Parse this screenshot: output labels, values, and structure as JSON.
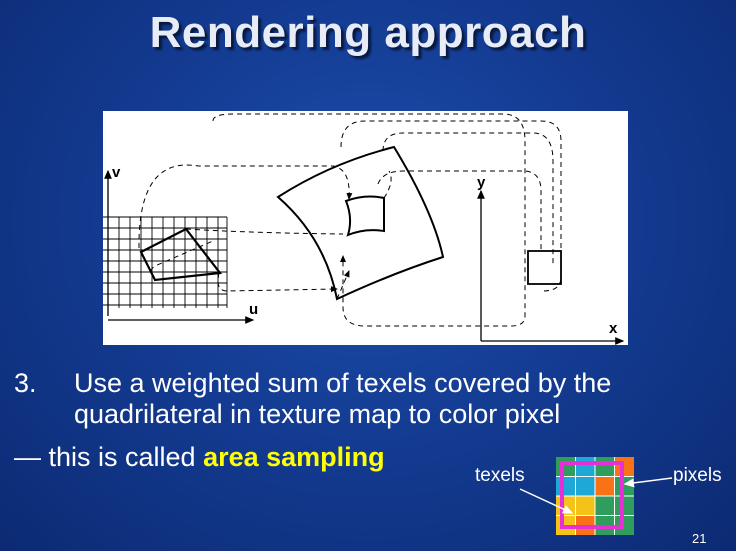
{
  "slide": {
    "title": "Rendering approach",
    "bullet_number": "3.",
    "bullet_text": "Use a weighted sum of texels covered by the quadrilateral in texture map to color pixel",
    "dash": "—",
    "note_prefix": " this is called ",
    "note_emphasis": "area sampling",
    "page_number": "21"
  },
  "figure": {
    "axis_labels": {
      "v": "v",
      "u": "u",
      "y": "y",
      "x": "x"
    }
  },
  "inset": {
    "texels_label": "texels",
    "pixels_label": "pixels",
    "colors": {
      "orange": "#f97316",
      "blue": "#1ea8d8",
      "green": "#2f9e5c",
      "yellow": "#f5c318",
      "magenta": "#e62fd6"
    }
  },
  "theme": {
    "background": "#143c93",
    "highlight": "#ffff00"
  }
}
